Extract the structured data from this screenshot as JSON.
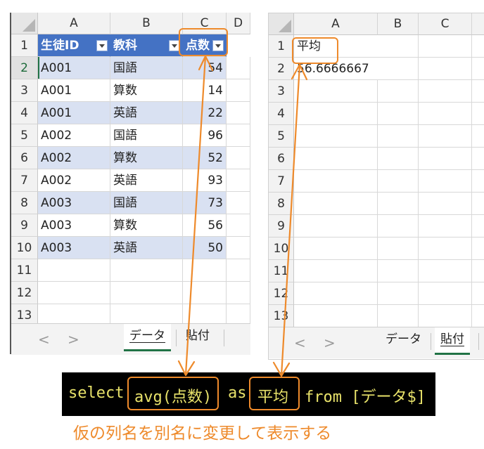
{
  "left_sheet": {
    "columns": [
      "A",
      "B",
      "C",
      "D"
    ],
    "header_row": [
      "生徒ID",
      "教科",
      "点数"
    ],
    "rows": [
      {
        "num": "1"
      },
      {
        "num": "2",
        "id": "A001",
        "subject": "国語",
        "score": "54"
      },
      {
        "num": "3",
        "id": "A001",
        "subject": "算数",
        "score": "14"
      },
      {
        "num": "4",
        "id": "A001",
        "subject": "英語",
        "score": "22"
      },
      {
        "num": "5",
        "id": "A002",
        "subject": "国語",
        "score": "96"
      },
      {
        "num": "6",
        "id": "A002",
        "subject": "算数",
        "score": "52"
      },
      {
        "num": "7",
        "id": "A002",
        "subject": "英語",
        "score": "93"
      },
      {
        "num": "8",
        "id": "A003",
        "subject": "国語",
        "score": "73"
      },
      {
        "num": "9",
        "id": "A003",
        "subject": "算数",
        "score": "56"
      },
      {
        "num": "10",
        "id": "A003",
        "subject": "英語",
        "score": "50"
      },
      {
        "num": "11"
      },
      {
        "num": "12"
      },
      {
        "num": "13"
      }
    ],
    "tabs": [
      "データ",
      "貼付"
    ],
    "nav_prev": "<",
    "nav_next": ">"
  },
  "right_sheet": {
    "columns": [
      "A",
      "B",
      "C"
    ],
    "rows": [
      "1",
      "2",
      "3",
      "4",
      "5",
      "6",
      "7",
      "8",
      "9",
      "10",
      "11",
      "12",
      "13"
    ],
    "header_cell": "平均",
    "value_cell": "56.6666667",
    "tabs": [
      "データ",
      "貼付"
    ],
    "nav_prev": "<",
    "nav_next": ">"
  },
  "sql": {
    "select": "select",
    "expr": "avg(点数)",
    "as": "as",
    "alias": "平均",
    "from": "from [データ$]"
  },
  "caption": "仮の列名を別名に変更して表示する",
  "colors": {
    "highlight": "#ee8a2b",
    "table_header": "#4472c4",
    "band": "#d9e1f2",
    "sql_text": "#e8e26a",
    "sql_bg": "#000000",
    "active_tab": "#217346"
  },
  "icons": [
    "filter-dropdown-icon",
    "sort-filter-icon",
    "select-all-corner-icon"
  ]
}
